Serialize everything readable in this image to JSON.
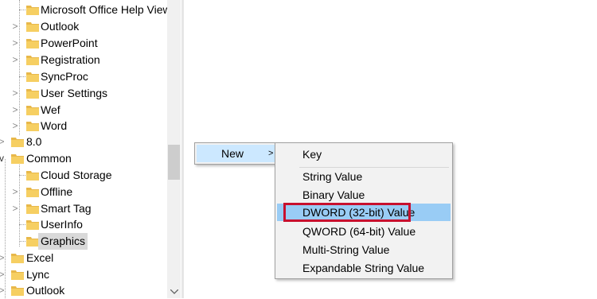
{
  "tree": {
    "items": [
      {
        "label": "Microsoft Office Help View",
        "chevron": ""
      },
      {
        "label": "Outlook",
        "chevron": ">"
      },
      {
        "label": "PowerPoint",
        "chevron": ">"
      },
      {
        "label": "Registration",
        "chevron": ">"
      },
      {
        "label": "SyncProc",
        "chevron": ""
      },
      {
        "label": "User Settings",
        "chevron": ">"
      },
      {
        "label": "Wef",
        "chevron": ">"
      },
      {
        "label": "Word",
        "chevron": ">"
      },
      {
        "label": "8.0",
        "chevron": ">"
      },
      {
        "label": "Common",
        "chevron": "v"
      },
      {
        "label": "Cloud Storage",
        "chevron": ""
      },
      {
        "label": "Offline",
        "chevron": ">"
      },
      {
        "label": "Smart Tag",
        "chevron": ">"
      },
      {
        "label": "UserInfo",
        "chevron": ""
      },
      {
        "label": "Graphics",
        "chevron": "",
        "selected": true
      },
      {
        "label": "Excel",
        "chevron": ">"
      },
      {
        "label": "Lync",
        "chevron": ">"
      },
      {
        "label": "Outlook",
        "chevron": ">"
      }
    ]
  },
  "context_menu": {
    "new_label": "New",
    "new_arrow": ">"
  },
  "submenu": {
    "items": [
      {
        "label": "Key"
      },
      {
        "label": "String Value"
      },
      {
        "label": "Binary Value"
      },
      {
        "label": "DWORD (32-bit) Value",
        "highlighted": true
      },
      {
        "label": "QWORD (64-bit) Value"
      },
      {
        "label": "Multi-String Value"
      },
      {
        "label": "Expandable String Value"
      }
    ]
  },
  "colors": {
    "folder": "#e8b84a",
    "hover": "#cce8ff",
    "highlight": "#99ccf5",
    "annotation_box": "#c8102e"
  }
}
